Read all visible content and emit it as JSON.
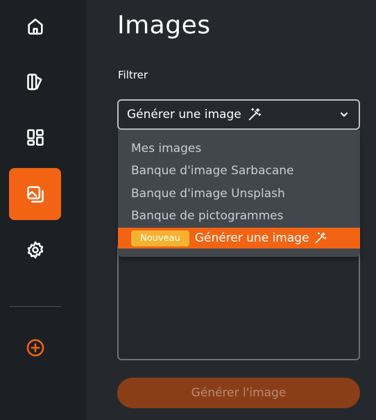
{
  "sidebar": {
    "items": [
      {
        "icon": "home-icon"
      },
      {
        "icon": "editor-icon"
      },
      {
        "icon": "templates-icon"
      },
      {
        "icon": "images-icon",
        "active": true
      },
      {
        "icon": "settings-icon"
      },
      {
        "icon": "add-circle-icon"
      }
    ]
  },
  "page": {
    "title": "Images",
    "filter_label": "Filtrer"
  },
  "filter": {
    "selected": "Générer une image",
    "options": [
      {
        "label": "Mes images"
      },
      {
        "label": "Banque d'image Sarbacane"
      },
      {
        "label": "Banque d'image Unsplash"
      },
      {
        "label": "Banque de pictogrammes"
      },
      {
        "label": "Générer une image",
        "badge": "Nouveau"
      }
    ]
  },
  "generate_button": {
    "label": "Générer l'image"
  },
  "colors": {
    "accent": "#f26414",
    "badge": "#f4b230",
    "sidebar_bg": "#1c2024",
    "main_bg": "#25292d",
    "dropdown_bg": "#41474c"
  }
}
